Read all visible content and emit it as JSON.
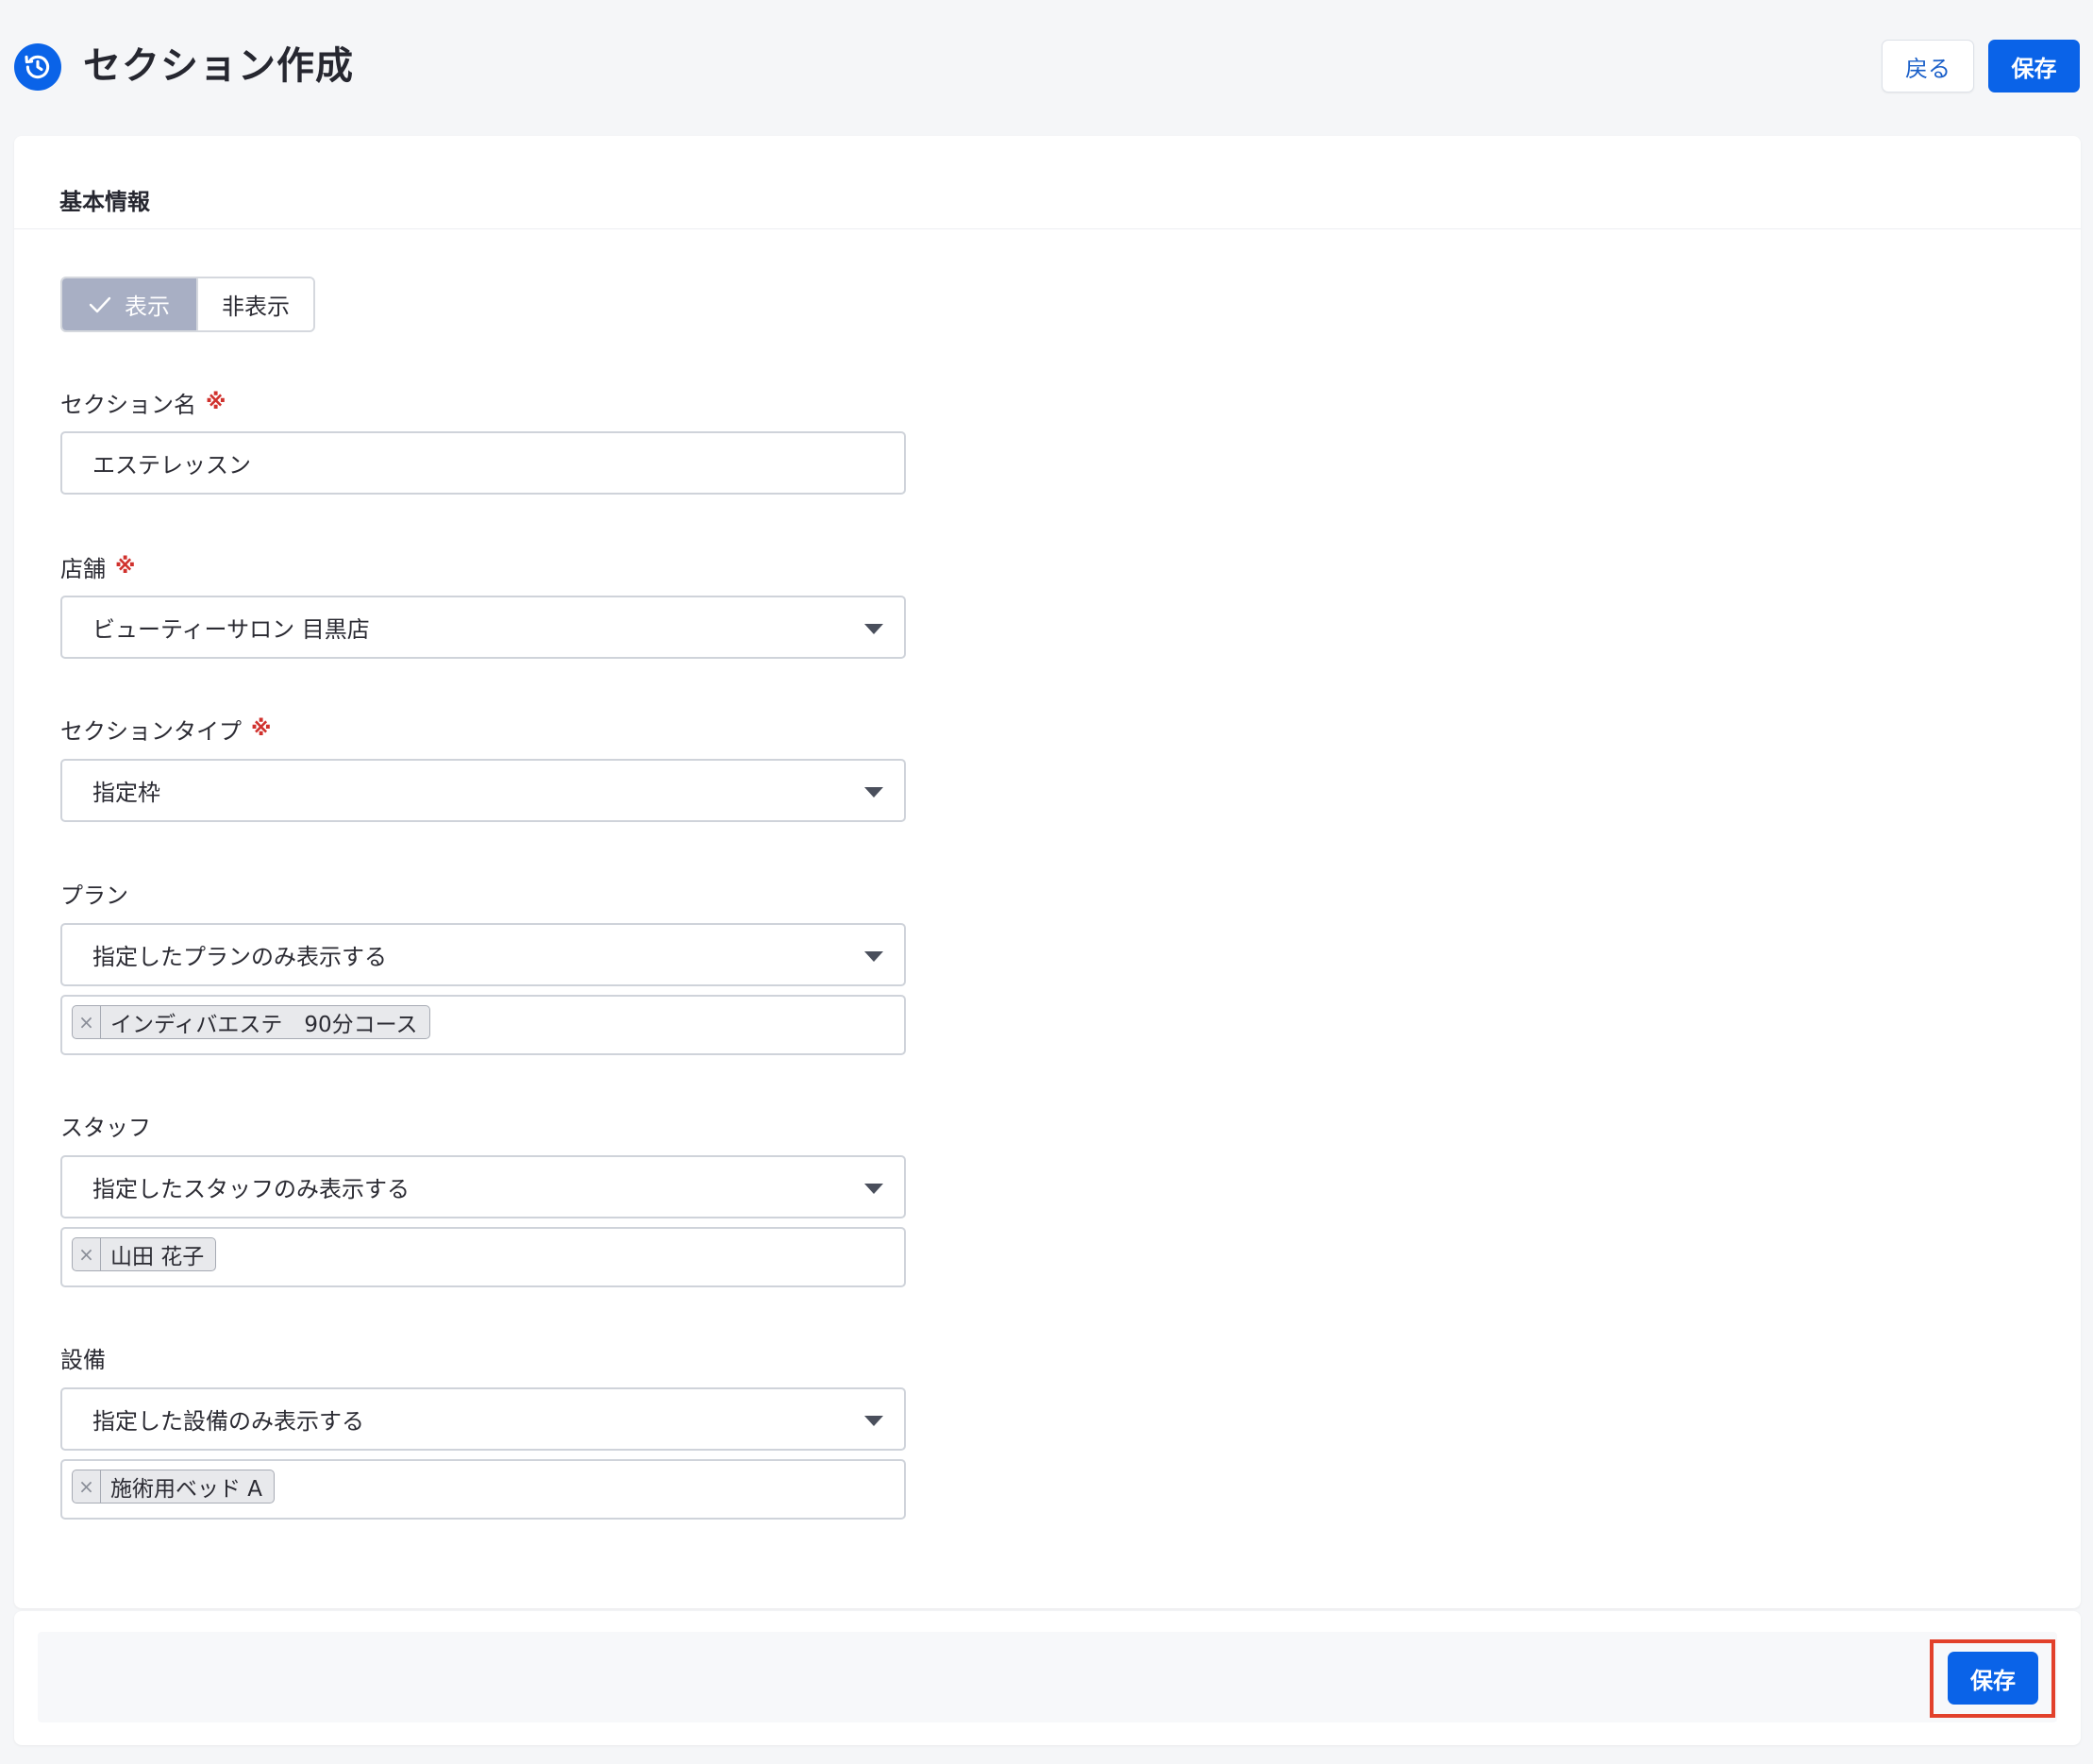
{
  "header": {
    "title": "セクション作成",
    "back_label": "戻る",
    "save_label": "保存"
  },
  "card": {
    "title": "基本情報"
  },
  "visibility_toggle": {
    "on_label": "表示",
    "off_label": "非表示",
    "selected": "表示"
  },
  "fields": {
    "section_name": {
      "label": "セクション名",
      "required_mark": "※",
      "value": "エステレッスン"
    },
    "store": {
      "label": "店舗",
      "required_mark": "※",
      "value": "ビューティーサロン 目黒店"
    },
    "section_type": {
      "label": "セクションタイプ",
      "required_mark": "※",
      "value": "指定枠"
    },
    "plan": {
      "label": "プラン",
      "value": "指定したプランのみ表示する",
      "tags": [
        "インディバエステ　90分コース"
      ]
    },
    "staff": {
      "label": "スタッフ",
      "value": "指定したスタッフのみ表示する",
      "tags": [
        "山田 花子"
      ]
    },
    "equipment": {
      "label": "設備",
      "value": "指定した設備のみ表示する",
      "tags": [
        "施術用ベッド A"
      ]
    }
  },
  "footer": {
    "save_label": "保存"
  },
  "colors": {
    "primary": "#0a63e8",
    "toggle_active": "#a8afc4",
    "required": "#d0312d",
    "highlight": "#e2412b"
  },
  "icons": {
    "header": "history-icon",
    "toggle_check": "check-icon",
    "dropdown": "chevron-down-icon",
    "tag_remove": "close-icon"
  }
}
